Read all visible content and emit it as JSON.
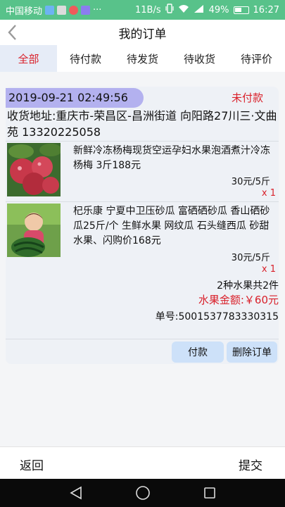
{
  "status_bar": {
    "carrier": "中国移动",
    "more": "···",
    "speed": "11B/s",
    "network": "4G",
    "battery": "49%",
    "time": "16:27"
  },
  "header": {
    "title": "我的订单",
    "back_icon": "back-arrow-icon"
  },
  "tabs": [
    {
      "label": "全部",
      "active": true
    },
    {
      "label": "待付款",
      "active": false
    },
    {
      "label": "待发货",
      "active": false
    },
    {
      "label": "待收货",
      "active": false
    },
    {
      "label": "待评价",
      "active": false
    }
  ],
  "order": {
    "datetime": "2019-09-21 02:49:56",
    "status": "未付款",
    "address": "收货地址:重庆市-荣昌区-昌洲街道 向阳路27川三·文曲苑 13320225058",
    "items": [
      {
        "name": "新鲜冷冻杨梅现货空运孕妇水果泡酒煮汁冷冻杨梅 3斤188元",
        "price": "30元/5斤",
        "qty": "x 1"
      },
      {
        "name": "杞乐康 宁夏中卫压砂瓜 富硒硒砂瓜 香山硒砂瓜25斤/个 生鲜水果 网纹瓜 石头缝西瓜 砂甜水果、闪购价168元",
        "price": "30元/5斤",
        "qty": "x 1"
      }
    ],
    "summary": "2种水果共2件",
    "amount_label": "水果金额:",
    "amount": "￥60元",
    "order_no": "单号:5001537783330315",
    "buttons": {
      "pay": "付款",
      "delete": "删除订单"
    }
  },
  "bottom_bar": {
    "back": "返回",
    "submit": "提交"
  },
  "colors": {
    "accent_red": "#d9202a",
    "status_bar": "#58c28a",
    "date_chip": "#b3b1ef",
    "button_bg": "#cde1f9",
    "active_tab_bg": "#e6ecf7"
  }
}
